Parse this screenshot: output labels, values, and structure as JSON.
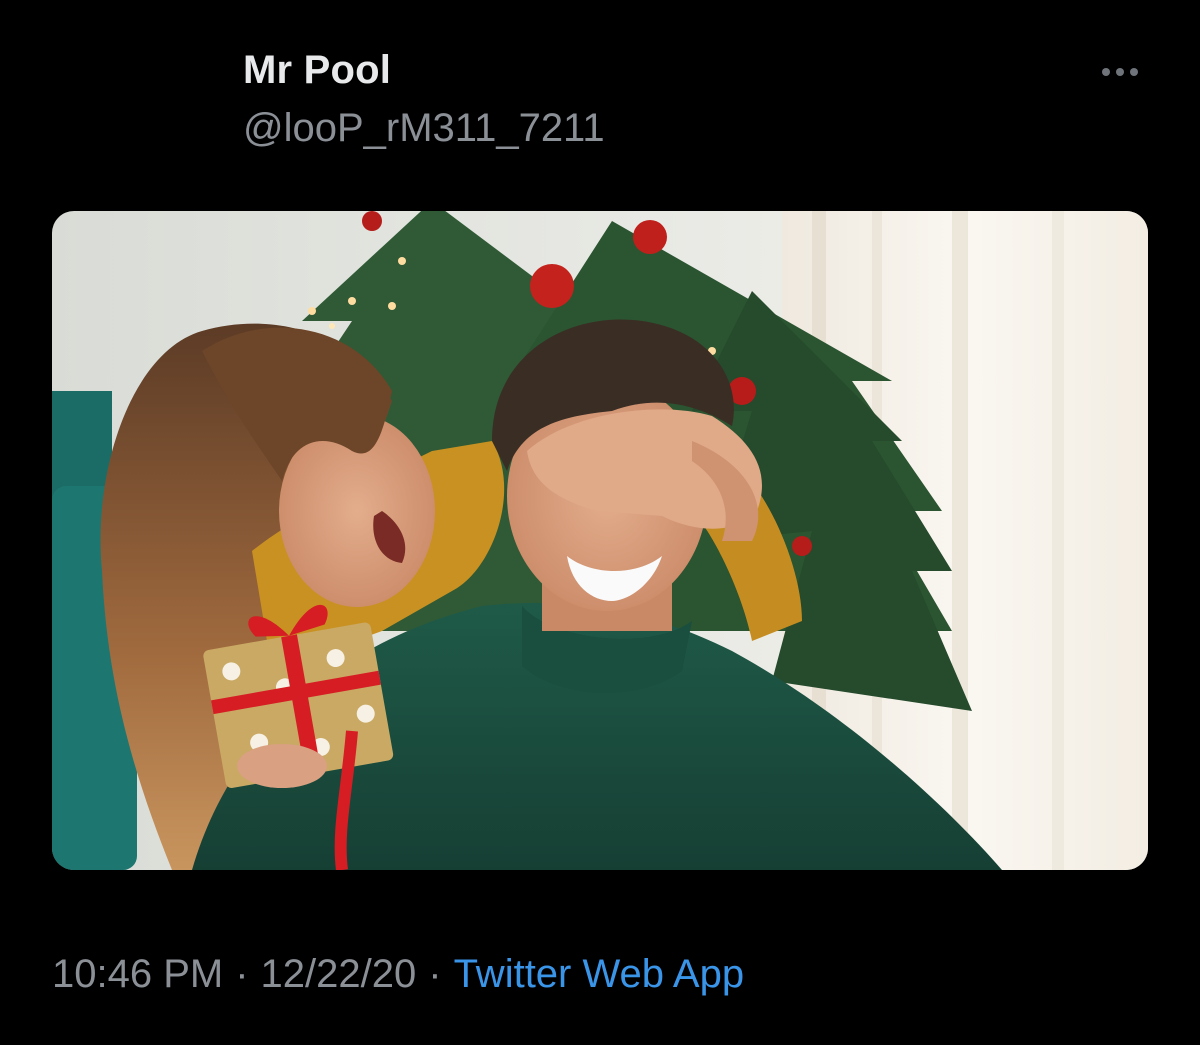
{
  "tweet": {
    "author": {
      "display_name": "Mr Pool",
      "handle": "@looP_rM311_7211"
    },
    "more_icon": "more-horizontal-icon",
    "media": {
      "type": "photo"
    },
    "timestamp": {
      "time": "10:46 PM",
      "date": "12/22/20",
      "separator": "·",
      "source": "Twitter Web App"
    }
  },
  "colors": {
    "background": "#000000",
    "name": "#e7e9ea",
    "secondary_text": "#8b9097",
    "link": "#3a95e8"
  }
}
